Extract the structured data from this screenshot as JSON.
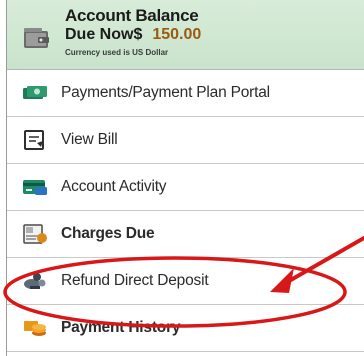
{
  "balance": {
    "title": "Account Balance",
    "due_label": "Due Now$",
    "due_amount": "150.00",
    "currency_note": "Currency used is US Dollar",
    "icon": "wallet-icon"
  },
  "menu": {
    "items": [
      {
        "label": "Payments/Payment Plan Portal",
        "icon": "money-icon",
        "bold": false
      },
      {
        "label": "View Bill",
        "icon": "bill-icon",
        "bold": false
      },
      {
        "label": "Account Activity",
        "icon": "credit-card-icon",
        "bold": false
      },
      {
        "label": "Charges Due",
        "icon": "invoice-icon",
        "bold": true
      },
      {
        "label": "Refund Direct Deposit",
        "icon": "deposit-icon",
        "bold": false
      },
      {
        "label": "Payment History",
        "icon": "coins-icon",
        "bold": true
      }
    ]
  },
  "annotation": {
    "color": "#d81818"
  }
}
